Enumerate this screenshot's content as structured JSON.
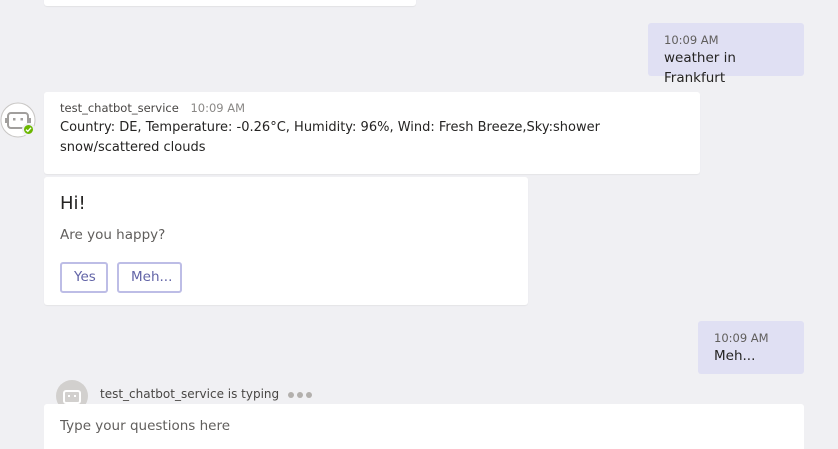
{
  "conversation": {
    "user_messages": [
      {
        "time": "10:09 AM",
        "text": "weather in Frankfurt"
      },
      {
        "time": "10:09 AM",
        "text": "Meh..."
      }
    ],
    "bot_message": {
      "sender": "test_chatbot_service",
      "time": "10:09 AM",
      "text": "Country: DE, Temperature: -0.26°C, Humidity: 96%, Wind: Fresh Breeze,Sky:shower snow/scattered clouds"
    },
    "hero_card": {
      "title": "Hi!",
      "subtitle": "Are you happy?",
      "buttons": [
        {
          "label": "Yes"
        },
        {
          "label": "Meh..."
        }
      ]
    },
    "typing_indicator": "test_chatbot_service is typing"
  },
  "composer": {
    "placeholder": "Type your questions here"
  },
  "colors": {
    "background": "#f0f0f3",
    "user_bubble": "#e0e0f3",
    "accent": "#6264a7",
    "presence_available": "#6bb700"
  }
}
